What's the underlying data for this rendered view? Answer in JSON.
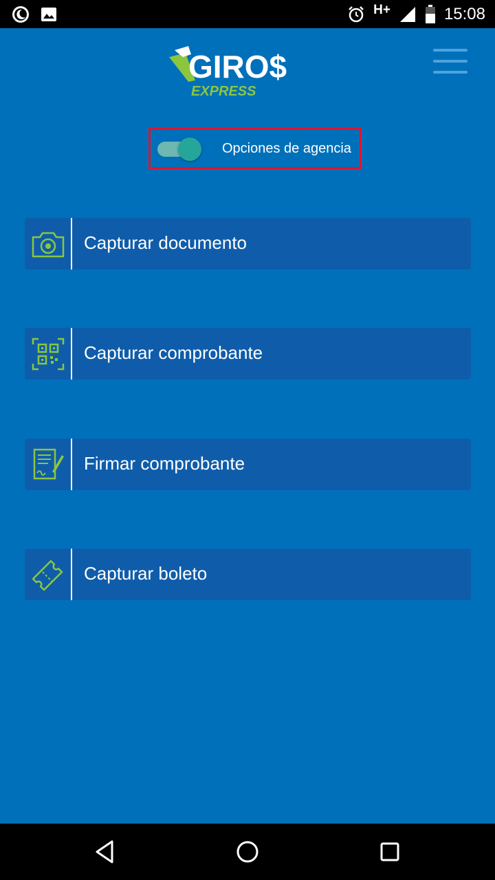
{
  "status_bar": {
    "time": "15:08",
    "network": "H+",
    "left_icons": [
      "moon-icon",
      "image-icon"
    ],
    "right_icons": [
      "alarm-icon",
      "signal-icon",
      "battery-icon"
    ]
  },
  "header": {
    "logo_main": "GIRO$",
    "logo_sub": "EXPRESS",
    "menu_icon": "hamburger-icon"
  },
  "agency_toggle": {
    "label": "Opciones de agencia",
    "checked": true
  },
  "menu_items": [
    {
      "label": "Capturar documento",
      "icon": "camera-icon"
    },
    {
      "label": "Capturar comprobante",
      "icon": "qr-code-icon"
    },
    {
      "label": "Firmar comprobante",
      "icon": "sign-document-icon"
    },
    {
      "label": "Capturar boleto",
      "icon": "ticket-icon"
    }
  ],
  "colors": {
    "background": "#0070bb",
    "card": "#0f5daa",
    "accent_green": "#8cc63f",
    "toggle_on": "#26a69a",
    "highlight": "#e3132b"
  },
  "nav_bar": {
    "buttons": [
      "back-icon",
      "home-icon",
      "recents-icon"
    ]
  }
}
